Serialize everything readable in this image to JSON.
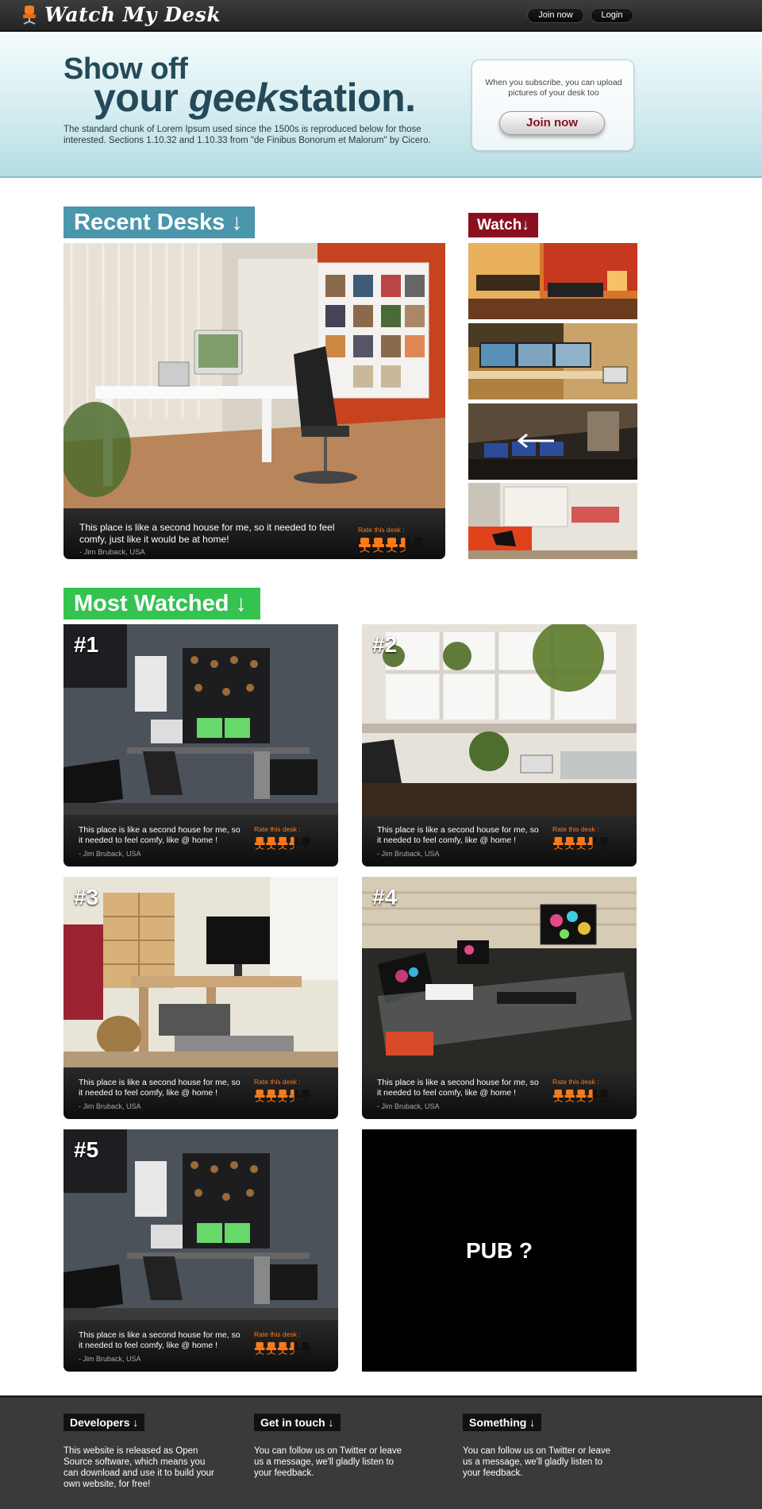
{
  "header": {
    "logo_text": "Watch My Desk",
    "join_label": "Join now",
    "login_label": "Login"
  },
  "hero": {
    "line1": "Show off",
    "line2_a": "your ",
    "line2_b": "geek",
    "line2_c": "station.",
    "description": "The standard chunk of Lorem Ipsum used since the 1500s is reproduced below for those interested. Sections 1.10.32 and 1.10.33 from \"de Finibus Bonorum et Malorum\" by Cicero.",
    "subscribe_text": "When you subscribe, you can upload pictures of your desk too",
    "join_button": "Join now"
  },
  "recent": {
    "heading": "Recent Desks ↓",
    "featured": {
      "quote": "This place is like a second house for me, so it needed to feel comfy, just like it would be at home!",
      "author": "- Jim Bruback, USA",
      "rate_label": "Rate this desk :",
      "rating": 3.5
    }
  },
  "watch": {
    "heading": "Watch↓"
  },
  "most_watched": {
    "heading": "Most Watched ↓",
    "cards": [
      {
        "rank": "#1",
        "quote": "This place is like a second house for me, so it needed to feel comfy, like @ home !",
        "author": "- Jim Bruback, USA",
        "rate_label": "Rate this desk :",
        "rating": 3.5
      },
      {
        "rank": "#2",
        "quote": "This place is like a second house for me, so it needed to feel comfy, like @ home !",
        "author": "- Jim Bruback, USA",
        "rate_label": "Rate this desk :",
        "rating": 3.5
      },
      {
        "rank": "#3",
        "quote": "This place is like a second house for me, so it needed to feel comfy, like @ home !",
        "author": "- Jim Bruback, USA",
        "rate_label": "Rate this desk :",
        "rating": 3.5
      },
      {
        "rank": "#4",
        "quote": "This place is like a second house for me, so it needed to feel comfy, like @ home !",
        "author": "- Jim Bruback, USA",
        "rate_label": "Rate this desk :",
        "rating": 3.5
      },
      {
        "rank": "#5",
        "quote": "This place is like a second house for me, so it needed to feel comfy, like @ home !",
        "author": "- Jim Bruback, USA",
        "rate_label": "Rate this desk :",
        "rating": 3.5
      }
    ],
    "pub_text": "PUB ?"
  },
  "footer": {
    "developers": {
      "heading": "Developers ↓",
      "text": "This website is released as Open Source software, which means you can download and use it to build your own website, for free!"
    },
    "get_in_touch": {
      "heading": "Get in touch ↓",
      "text": "You can follow us on Twitter or leave us a message, we'll gladly listen to your feedback."
    },
    "something": {
      "heading": "Something ↓",
      "text": "You can follow us on Twitter or leave us a message, we'll gladly listen to your feedback."
    }
  },
  "colors": {
    "recent_heading": "#4a96ab",
    "watch_heading": "#8a1020",
    "most_watched_heading": "#34c251",
    "rating_active": "#ff7a1a",
    "rating_inactive": "#111111"
  },
  "icons": {
    "logo": "office-chair-icon",
    "rating": "office-chair-icon",
    "thumb_3_overlay": "arrow-left-icon"
  }
}
